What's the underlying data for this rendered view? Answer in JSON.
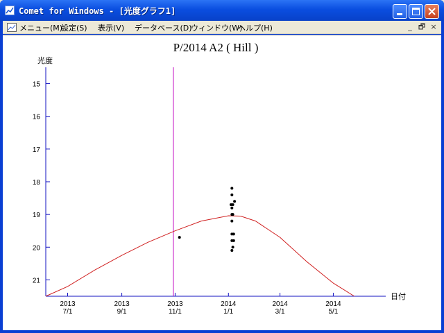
{
  "window": {
    "title": "Comet for Windows - [光度グラフ1]",
    "buttons": {
      "minimize": "minimize",
      "maximize": "maximize",
      "close": "close"
    }
  },
  "menu": {
    "items": [
      "メニュー(M)",
      "設定(S)",
      "表示(V)",
      "データベース(D)",
      "ウィンドウ(W)",
      "ヘルプ(H)"
    ],
    "mdi_buttons": [
      "_",
      "🗗",
      "×"
    ]
  },
  "chart_data": {
    "type": "scatter",
    "title": "P/2014 A2 ( Hill )",
    "ylabel": "光度",
    "xlabel": "日付",
    "y_axis": {
      "inverted": true,
      "ticks": [
        15,
        16,
        17,
        18,
        19,
        20,
        21
      ],
      "range": [
        14.5,
        21.5
      ]
    },
    "x_axis": {
      "ticks": [
        {
          "year": "2013",
          "date": "7/1"
        },
        {
          "year": "2013",
          "date": "9/1"
        },
        {
          "year": "2013",
          "date": "11/1"
        },
        {
          "year": "2014",
          "date": "1/1"
        },
        {
          "year": "2014",
          "date": "3/1"
        },
        {
          "year": "2014",
          "date": "5/1"
        }
      ],
      "range": [
        "2013-06-06",
        "2014-06-30"
      ]
    },
    "vertical_marker": {
      "date": "2013-10-30",
      "color": "#c000c0"
    },
    "curve": {
      "color": "#d02020",
      "points": [
        [
          "2013-06-06",
          21.5
        ],
        [
          "2013-07-01",
          21.2
        ],
        [
          "2013-08-01",
          20.7
        ],
        [
          "2013-09-01",
          20.25
        ],
        [
          "2013-10-01",
          19.85
        ],
        [
          "2013-11-01",
          19.5
        ],
        [
          "2013-12-01",
          19.2
        ],
        [
          "2014-01-01",
          19.04
        ],
        [
          "2014-01-15",
          19.05
        ],
        [
          "2014-02-01",
          19.2
        ],
        [
          "2014-03-01",
          19.7
        ],
        [
          "2014-04-01",
          20.45
        ],
        [
          "2014-05-01",
          21.1
        ],
        [
          "2014-05-25",
          21.5
        ]
      ]
    },
    "observations": [
      [
        "2013-11-06",
        19.7
      ],
      [
        "2014-01-05",
        18.2
      ],
      [
        "2014-01-05",
        18.4
      ],
      [
        "2014-01-04",
        18.7
      ],
      [
        "2014-01-06",
        18.7
      ],
      [
        "2014-01-05",
        18.8
      ],
      [
        "2014-01-08",
        18.6
      ],
      [
        "2014-01-05",
        19.0
      ],
      [
        "2014-01-06",
        19.0
      ],
      [
        "2014-01-05",
        19.2
      ],
      [
        "2014-01-05",
        19.6
      ],
      [
        "2014-01-07",
        19.6
      ],
      [
        "2014-01-05",
        19.8
      ],
      [
        "2014-01-07",
        19.8
      ],
      [
        "2014-01-06",
        20.0
      ],
      [
        "2014-01-05",
        20.1
      ]
    ]
  }
}
